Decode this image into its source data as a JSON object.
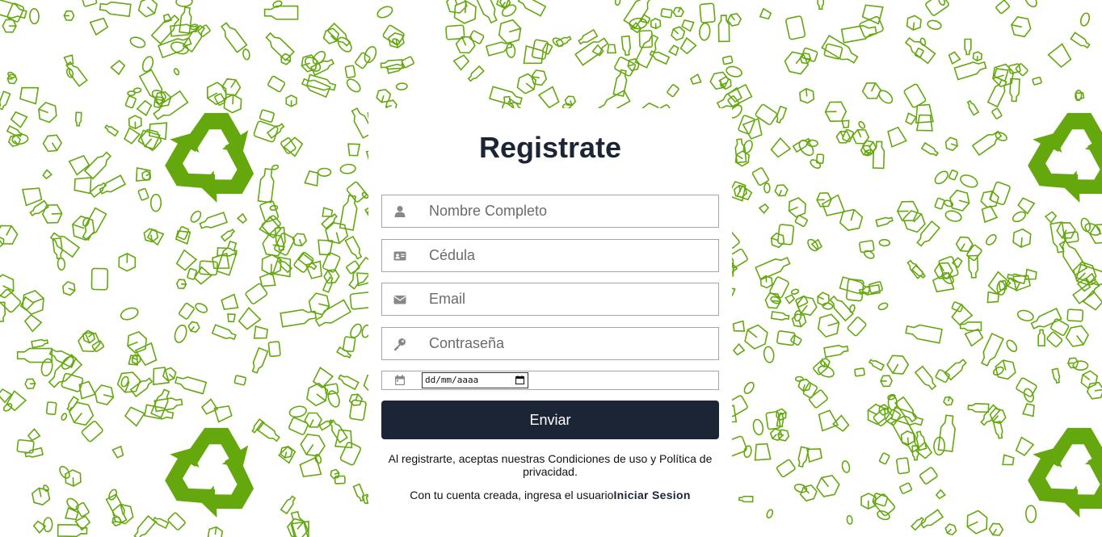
{
  "colors": {
    "accent_green": "#64a80e",
    "dark_navy": "#1c2536",
    "icon_gray": "#888888"
  },
  "form": {
    "title": "Registrate",
    "fields": [
      {
        "icon": "user-icon",
        "placeholder": "Nombre Completo"
      },
      {
        "icon": "id-card-icon",
        "placeholder": "Cédula"
      },
      {
        "icon": "envelope-icon",
        "placeholder": "Email"
      },
      {
        "icon": "key-icon",
        "placeholder": "Contraseña"
      }
    ],
    "date": {
      "icon": "calendar-icon",
      "placeholder": "dd/mm/aaaa"
    },
    "submit_label": "Enviar",
    "terms_text": "Al registrarte, aceptas nuestras Condiciones de uso y Política de privacidad.",
    "login_prompt": "Con tu cuenta creada, ingresa el usuario",
    "login_link": "Iniciar Sesion"
  },
  "background": {
    "pattern": "recycling-doodle-pattern",
    "recycle_icon": "recycle-icon"
  }
}
